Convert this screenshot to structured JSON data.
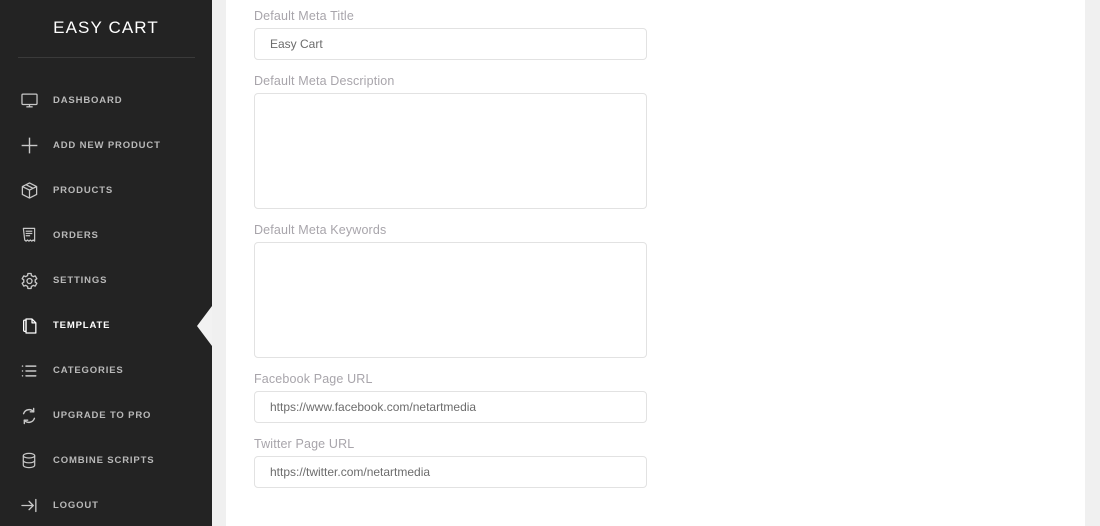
{
  "sidebar": {
    "brand": "EASY CART",
    "items": [
      {
        "label": "DASHBOARD",
        "icon": "monitor-icon",
        "active": false
      },
      {
        "label": "ADD NEW PRODUCT",
        "icon": "plus-icon",
        "active": false
      },
      {
        "label": "PRODUCTS",
        "icon": "box-icon",
        "active": false
      },
      {
        "label": "ORDERS",
        "icon": "receipt-icon",
        "active": false
      },
      {
        "label": "SETTINGS",
        "icon": "gear-icon",
        "active": false
      },
      {
        "label": "TEMPLATE",
        "icon": "document-page-icon",
        "active": true
      },
      {
        "label": "CATEGORIES",
        "icon": "list-icon",
        "active": false
      },
      {
        "label": "UPGRADE TO PRO",
        "icon": "refresh-cycle-icon",
        "active": false
      },
      {
        "label": "COMBINE SCRIPTS",
        "icon": "database-icon",
        "active": false
      },
      {
        "label": "LOGOUT",
        "icon": "logout-arrow-icon",
        "active": false
      }
    ]
  },
  "main": {
    "fields": [
      {
        "name": "default-meta-title",
        "label": "Default Meta Title",
        "type": "input",
        "value": "Easy Cart",
        "placeholder": ""
      },
      {
        "name": "default-meta-description",
        "label": "Default Meta Description",
        "type": "textarea",
        "value": "",
        "placeholder": ""
      },
      {
        "name": "default-meta-keywords",
        "label": "Default Meta Keywords",
        "type": "textarea",
        "value": "",
        "placeholder": ""
      },
      {
        "name": "facebook-page-url",
        "label": "Facebook Page URL",
        "type": "input",
        "value": "https://www.facebook.com/netartmedia",
        "placeholder": ""
      },
      {
        "name": "twitter-page-url",
        "label": "Twitter Page URL",
        "type": "input",
        "value": "https://twitter.com/netartmedia",
        "placeholder": ""
      }
    ]
  },
  "colors": {
    "sidebar_bg": "#232323",
    "sidebar_text": "#b9b9b9",
    "sidebar_active_text": "#ffffff",
    "content_bg": "#ffffff",
    "label_text": "#a8a5ab",
    "input_border": "#e2e2e2",
    "input_text": "#6c6c6c",
    "gutter": "#f0f0f0"
  }
}
